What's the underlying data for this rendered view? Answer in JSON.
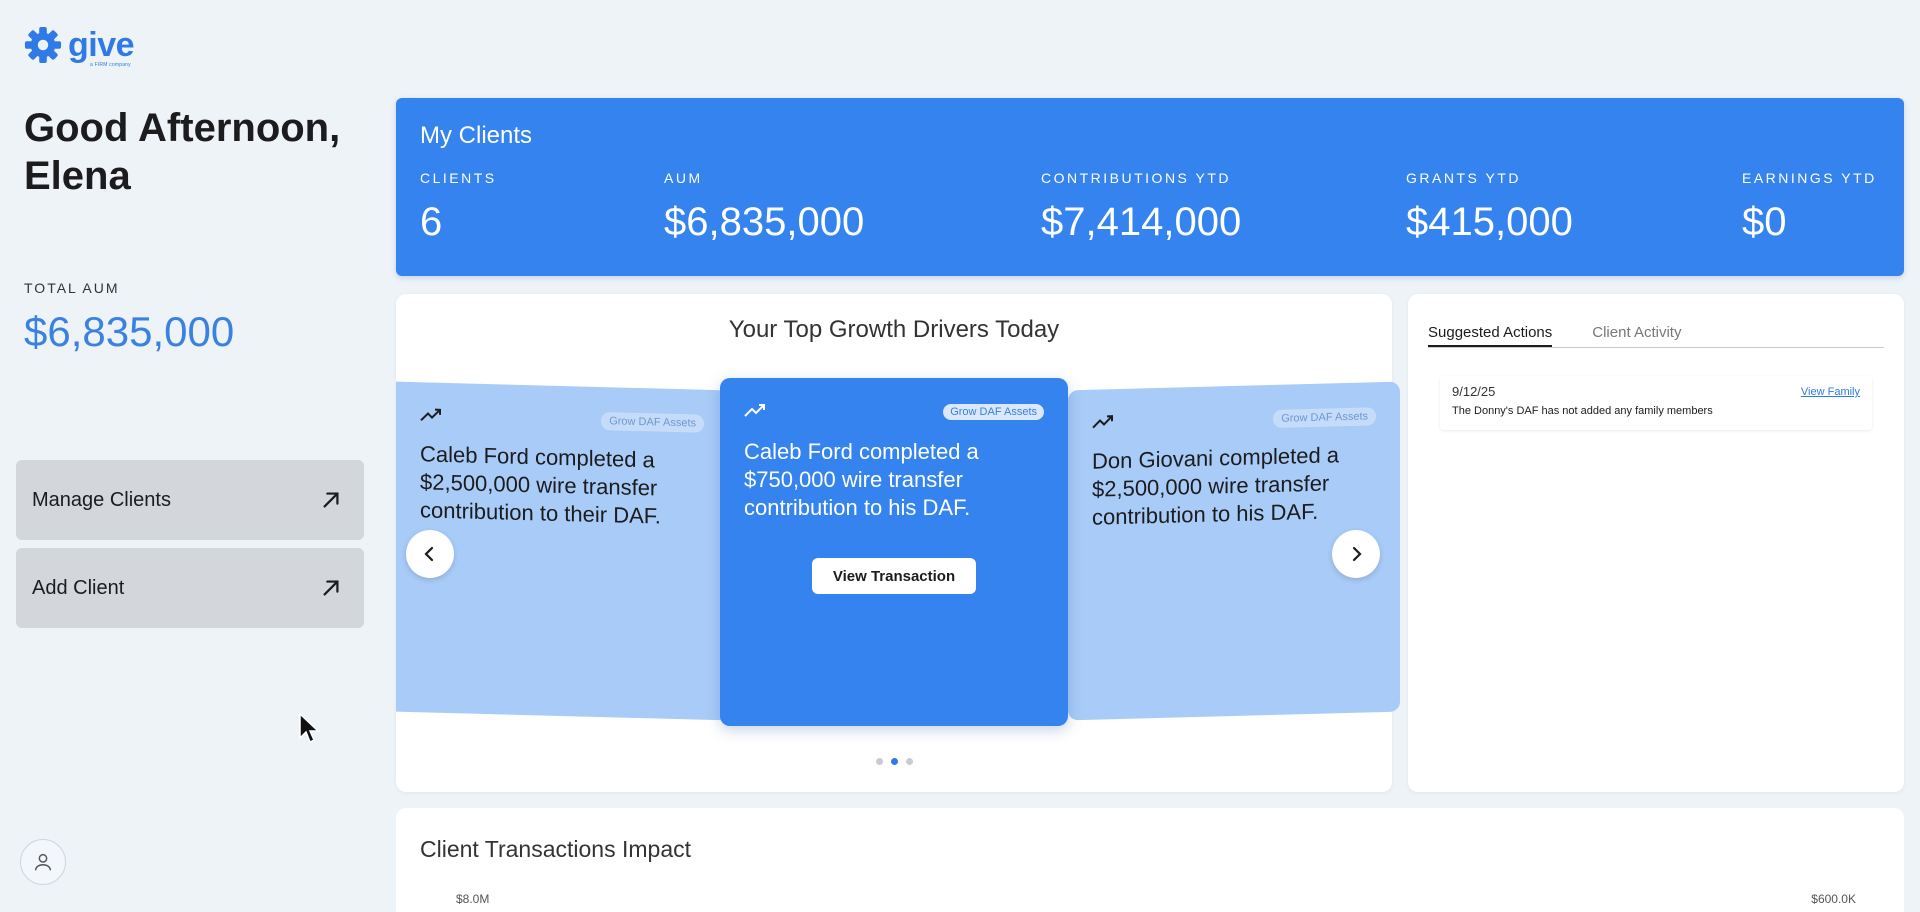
{
  "logo": {
    "word": "give",
    "sub": "a FIRM company"
  },
  "greeting": "Good Afternoon, Elena",
  "total_aum": {
    "label": "TOTAL AUM",
    "value": "$6,835,000"
  },
  "sidebar": {
    "manage_clients": "Manage Clients",
    "add_client": "Add Client"
  },
  "clients_banner": {
    "title": "My Clients",
    "stats": [
      {
        "label": "CLIENTS",
        "value": "6"
      },
      {
        "label": "AUM",
        "value": "$6,835,000"
      },
      {
        "label": "CONTRIBUTIONS YTD",
        "value": "$7,414,000"
      },
      {
        "label": "GRANTS YTD",
        "value": "$415,000"
      },
      {
        "label": "EARNINGS YTD",
        "value": "$0"
      }
    ]
  },
  "growth": {
    "title": "Your Top Growth Drivers Today",
    "cards": [
      {
        "tag": "Grow DAF Assets",
        "text": "Caleb Ford completed a $2,500,000 wire transfer contribution to their DAF."
      },
      {
        "tag": "Grow DAF Assets",
        "text": "Caleb Ford completed a $750,000 wire transfer contribution to his DAF.",
        "button": "View Transaction"
      },
      {
        "tag": "Grow DAF Assets",
        "text": "Don Giovani completed a $2,500,000 wire transfer contribution to his DAF."
      }
    ],
    "active_dot": 2,
    "dot_count": 3
  },
  "actions": {
    "tabs": [
      "Suggested Actions",
      "Client Activity"
    ],
    "active_tab": "Suggested Actions",
    "items": [
      {
        "date": "9/12/25",
        "link": "View Family",
        "text": "The Donny's DAF has not added any family members"
      }
    ]
  },
  "impact": {
    "title": "Client Transactions Impact",
    "left_axis_top": "$8.0M",
    "right_axis_top": "$600.0K"
  },
  "colors": {
    "accent": "#3583ee",
    "side_card": "#a9cbf7",
    "background": "#eef3f8",
    "button_gray": "#d3d6da"
  }
}
